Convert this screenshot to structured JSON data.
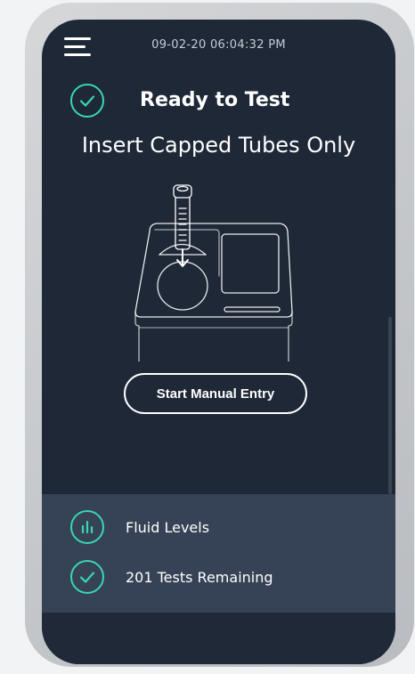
{
  "header": {
    "datetime": "09-02-20 06:04:32 PM",
    "menu_icon": "hamburger-menu-icon"
  },
  "status": {
    "title": "Ready to Test",
    "instruction": "Insert Capped Tubes Only",
    "icon": "check-circle-icon"
  },
  "actions": {
    "start_manual_entry": "Start Manual Entry"
  },
  "panel": {
    "items": [
      {
        "icon": "bar-chart-icon",
        "label": "Fluid Levels"
      },
      {
        "icon": "check-circle-icon",
        "label": "201 Tests Remaining"
      }
    ]
  },
  "colors": {
    "background": "#1e2837",
    "panel": "#364255",
    "accent": "#39d6b5",
    "bezel": "#c8cbce"
  }
}
